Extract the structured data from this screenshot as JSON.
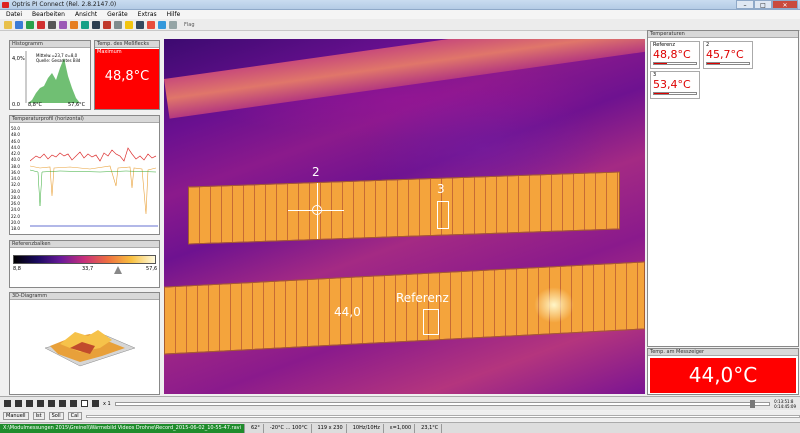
{
  "window": {
    "title": "Optris PI Connect (Rel. 2.8.2147.0)"
  },
  "menu": [
    "Datei",
    "Bearbeiten",
    "Ansicht",
    "Geräte",
    "Extras",
    "Hilfe"
  ],
  "toolbar": {
    "flag_label": "Flag"
  },
  "histogram": {
    "title": "Histogramm",
    "y_top": "4,0%",
    "y_bottom": "0.0",
    "x_left": "8,8°C",
    "x_right": "57,6°C",
    "info_line1": "Mittelw.=23,7 σ=8,0",
    "info_line2": "Quelle: Gesamtes Bild"
  },
  "max_box": {
    "title": "Temp. des Meßflecks",
    "label": "Maximum",
    "value": "48,8°C"
  },
  "profile": {
    "title": "Temperaturprofil (horizontal)",
    "y_ticks": [
      "50.0",
      "48.0",
      "46.0",
      "44.0",
      "42.0",
      "40.0",
      "38.0",
      "36.0",
      "34.0",
      "32.0",
      "30.0",
      "28.0",
      "26.0",
      "24.0",
      "22.0",
      "20.0",
      "18.0"
    ]
  },
  "refbar": {
    "title": "Referenzbalken",
    "min": "8,8",
    "mid": "33,7",
    "max": "57,6"
  },
  "diagram3d": {
    "title": "3D-Diagramm"
  },
  "image": {
    "spot2_label": "2",
    "spot3_label": "3",
    "spot_value": "44,0",
    "ref_label": "Referenz"
  },
  "temperatures": {
    "title": "Temperaturen",
    "items": [
      {
        "name": "Referenz",
        "value": "48,8°C"
      },
      {
        "name": "2",
        "value": "45,7°C"
      },
      {
        "name": "3",
        "value": "53,4°C"
      }
    ]
  },
  "measure": {
    "title": "Temp. am Messzeiger",
    "value": "44,0°C"
  },
  "playback": {
    "speed": "x 1",
    "time_a": "0:13:51:8",
    "time_b": "0:14:45:09"
  },
  "manual_row": {
    "mode": "Manuell",
    "buttons": [
      "Ist",
      "Soll",
      "Cal"
    ]
  },
  "status": {
    "file": "X:\\Modulmessungen 2015\\Greinel\\Wärmebild Videos Drohne\\Record_2015-06-02_10-55-47.ravi",
    "items": [
      "62°",
      "-20°C ... 100°C",
      "119 x 230",
      "10Hz/10Hz",
      "ε=1,000",
      "23,1°C"
    ]
  },
  "colors": {
    "max_bg": "#ff0000",
    "temp_text": "#dd0000",
    "status_green": "#1f8c2c"
  }
}
